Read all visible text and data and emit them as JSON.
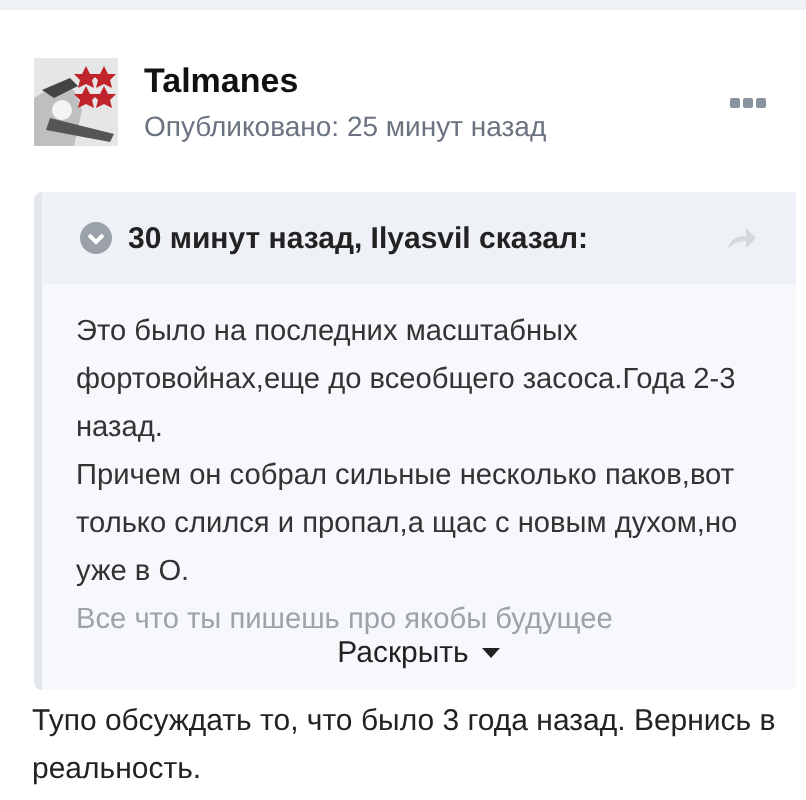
{
  "post": {
    "author": "Talmanes",
    "published": "Опубликовано: 25 минут назад"
  },
  "quote": {
    "header": "30 минут назад, Ilyasvil сказал:",
    "paragraphs": [
      {
        "kind": "text",
        "text": "Это было на последних масштабных фортовойнах,еще до всеобщего засоса.Года 2-3 назад."
      },
      {
        "kind": "text",
        "text": "Причем он собрал сильные несколько паков,вот только слился и пропал,а щас с новым духом,но уже в О."
      },
      {
        "kind": "faded",
        "text": "Все что ты пишешь про якобы будущее"
      }
    ],
    "expand": "Раскрыть"
  },
  "reply": "Тупо обсуждать то, что было 3 года назад. Вернись в реальность."
}
